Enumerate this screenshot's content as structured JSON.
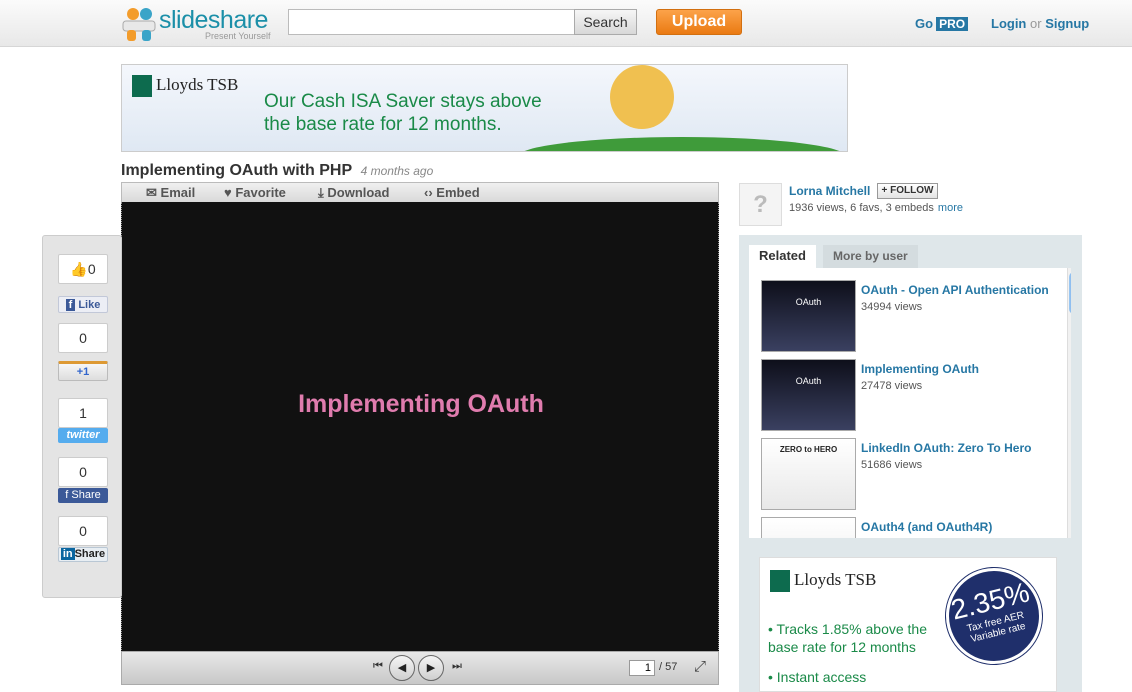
{
  "header": {
    "logo_text": "slideshare",
    "logo_tagline": "Present Yourself",
    "search_button": "Search",
    "search_value": "",
    "upload_button": "Upload",
    "go_label": "Go",
    "pro_label": "PRO",
    "login": "Login",
    "or": "or",
    "signup": "Signup"
  },
  "top_ad": {
    "brand": "Lloyds TSB",
    "headline": "Our Cash ISA Saver stays above the base rate for 12 months."
  },
  "presentation": {
    "title": "Implementing OAuth with PHP",
    "age": "4 months ago",
    "slide_title": "Implementing OAuth",
    "current_page": "1",
    "total_pages": "/ 57"
  },
  "toolbar": {
    "email": "Email",
    "favorite": "Favorite",
    "download": "Download",
    "embed": "Embed"
  },
  "social": {
    "fb_like_count": "0",
    "fb_like_label": "Like",
    "gplus_count": "0",
    "gplus_label": "+1",
    "twitter_count": "1",
    "twitter_label": "twitter",
    "fb_share_count": "0",
    "fb_share_label": "Share",
    "in_share_count": "0",
    "in_share_label": "Share"
  },
  "author": {
    "name": "Lorna Mitchell",
    "follow_label": "+ FOLLOW",
    "stats": "1936 views, 6 favs, 3 embeds",
    "more": "more"
  },
  "related": {
    "tab_related": "Related",
    "tab_more": "More by user",
    "items": [
      {
        "title": "OAuth - Open API Authentication",
        "views": "34994 views",
        "thumb": "OAuth"
      },
      {
        "title": "Implementing OAuth",
        "views": "27478 views",
        "thumb": "OAuth"
      },
      {
        "title": "LinkedIn OAuth: Zero To Hero",
        "views": "51686 views",
        "thumb": "ZERO to HERO"
      },
      {
        "title": "OAuth4 (and OAuth4R)",
        "views": "",
        "thumb": ""
      }
    ]
  },
  "side_ad": {
    "brand": "Lloyds TSB",
    "rate": "2.35%",
    "rate_sub": "Tax free AER Variable rate",
    "point1": "• Tracks 1.85% above the base rate for 12 months",
    "point2": "• Instant access"
  }
}
